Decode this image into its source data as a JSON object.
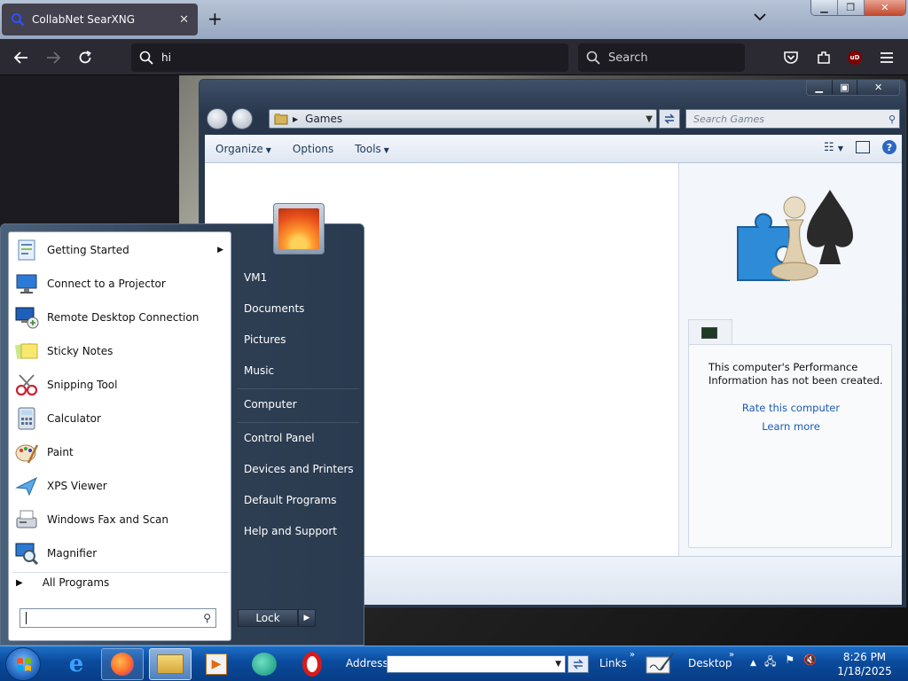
{
  "browser": {
    "tab_title": "CollabNet SearXNG",
    "tab_close": "✕",
    "new_tab": "+",
    "list_all_tabs": "⌄",
    "window_controls": {
      "minimize": "▁",
      "restore": "❐",
      "close": "✕"
    },
    "url_value": "hi",
    "search_placeholder": "Search",
    "ublock_badge": "uD"
  },
  "explorer": {
    "window_controls": {
      "minimize": "▁",
      "maximize": "▣",
      "close": "✕"
    },
    "address_crumb": "Games",
    "search_placeholder": "Search Games",
    "toolbar": {
      "organize": "Organize",
      "options": "Options",
      "tools": "Tools"
    },
    "performance": {
      "message": "This computer's Performance Information has not been created.",
      "rate_link": "Rate this computer",
      "learn_link": "Learn more"
    }
  },
  "start_menu": {
    "programs": [
      {
        "label": "Getting Started",
        "icon": "getting-started-icon",
        "submenu": true
      },
      {
        "label": "Connect to a Projector",
        "icon": "projector-icon",
        "submenu": false
      },
      {
        "label": "Remote Desktop Connection",
        "icon": "remote-desktop-icon",
        "submenu": false
      },
      {
        "label": "Sticky Notes",
        "icon": "sticky-notes-icon",
        "submenu": false
      },
      {
        "label": "Snipping Tool",
        "icon": "snipping-tool-icon",
        "submenu": false
      },
      {
        "label": "Calculator",
        "icon": "calculator-icon",
        "submenu": false
      },
      {
        "label": "Paint",
        "icon": "paint-icon",
        "submenu": false
      },
      {
        "label": "XPS Viewer",
        "icon": "xps-viewer-icon",
        "submenu": false
      },
      {
        "label": "Windows Fax and Scan",
        "icon": "fax-scan-icon",
        "submenu": false
      },
      {
        "label": "Magnifier",
        "icon": "magnifier-icon",
        "submenu": false
      }
    ],
    "all_programs": "All Programs",
    "places": [
      "VM1",
      "Documents",
      "Pictures",
      "Music",
      "Computer",
      "Control Panel",
      "Devices and Printers",
      "Default Programs",
      "Help and Support"
    ],
    "lock": "Lock",
    "lock_arrow": "▶"
  },
  "taskbar": {
    "address_label": "Address",
    "links_label": "Links",
    "desktop_label": "Desktop",
    "time": "8:26 PM",
    "date": "1/18/2025"
  },
  "colors": {
    "taskbar": "#0a4a9c",
    "link": "#1c5bb5",
    "firefox_toolbar": "#2b2a33"
  }
}
